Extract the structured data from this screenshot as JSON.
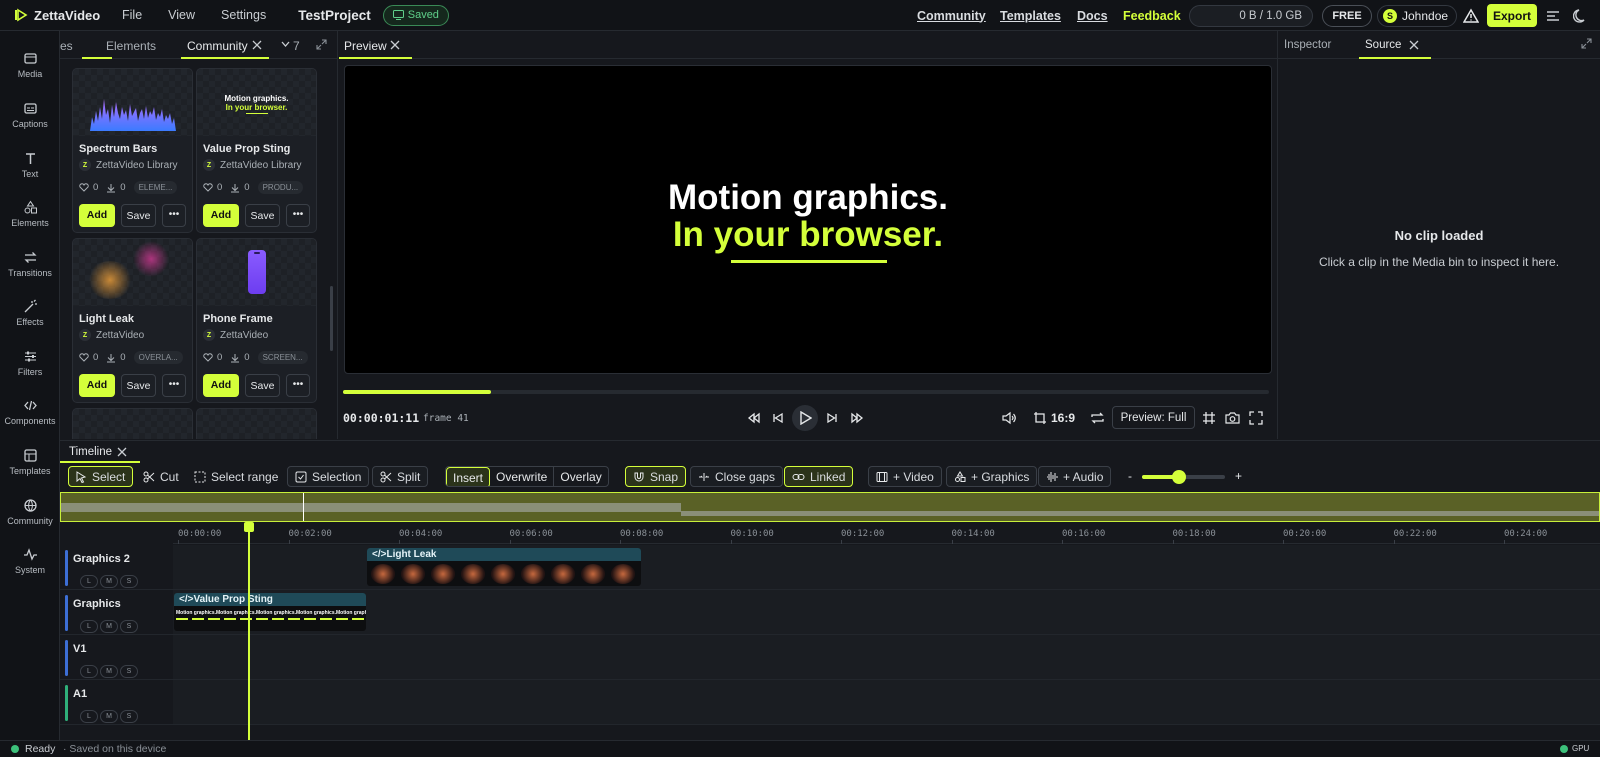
{
  "app": {
    "name": "ZettaVideo",
    "menu": [
      "File",
      "View",
      "Settings"
    ],
    "project": "TestProject",
    "saved": "Saved"
  },
  "toplinks": {
    "community": "Community",
    "templates": "Templates",
    "docs": "Docs",
    "feedback": "Feedback"
  },
  "storage": "0 B / 1.0 GB",
  "plan": "FREE",
  "user": {
    "initial": "S",
    "name": "Johndoe"
  },
  "export_label": "Export",
  "rail": [
    "Media",
    "Captions",
    "Text",
    "Elements",
    "Transitions",
    "Effects",
    "Filters",
    "Components",
    "Templates",
    "Community",
    "System"
  ],
  "library": {
    "tabs": {
      "partial": "es",
      "elements": "Elements",
      "community": "Community",
      "overflow": "7"
    },
    "cards": [
      {
        "title": "Spectrum Bars",
        "author": "ZettaVideo Library",
        "likes": "0",
        "downloads": "0",
        "tag": "ELEME...",
        "add": "Add",
        "save": "Save"
      },
      {
        "title": "Value Prop Sting",
        "author": "ZettaVideo Library",
        "likes": "0",
        "downloads": "0",
        "tag": "PRODU...",
        "add": "Add",
        "save": "Save",
        "thumb_l1": "Motion graphics.",
        "thumb_l2": "In your browser."
      },
      {
        "title": "Light Leak",
        "author": "ZettaVideo",
        "likes": "0",
        "downloads": "0",
        "tag": "OVERLA...",
        "add": "Add",
        "save": "Save"
      },
      {
        "title": "Phone Frame",
        "author": "ZettaVideo",
        "likes": "0",
        "downloads": "0",
        "tag": "SCREEN...",
        "add": "Add",
        "save": "Save"
      }
    ]
  },
  "preview": {
    "tab": "Preview",
    "line1": "Motion graphics.",
    "line2": "In your browser.",
    "timecode": "00:00:01:11",
    "frame": "frame 41",
    "progress": 0.16,
    "aspect": "16:9",
    "quality": "Preview: Full"
  },
  "inspector": {
    "tab1": "Inspector",
    "tab2": "Source",
    "empty_title": "No clip loaded",
    "empty_hint": "Click a clip in the Media bin to inspect it here."
  },
  "timeline": {
    "tab": "Timeline",
    "tools": {
      "select": "Select",
      "cut": "Cut",
      "select_range": "Select range",
      "selection": "Selection",
      "split": "Split"
    },
    "modes": [
      "Insert",
      "Overwrite",
      "Overlay"
    ],
    "snap": "Snap",
    "close_gaps": "Close gaps",
    "linked": "Linked",
    "add_video": "+ Video",
    "add_graphics": "+ Graphics",
    "add_audio": "+ Audio",
    "zoom_minus": "-",
    "zoom_plus": "+",
    "ruler": [
      "00:00:00",
      "00:02:00",
      "00:04:00",
      "00:06:00",
      "00:08:00",
      "00:10:00",
      "00:12:00",
      "00:14:00",
      "00:16:00",
      "00:18:00",
      "00:20:00",
      "00:22:00",
      "00:24:00"
    ],
    "tracks": [
      {
        "name": "Graphics 2",
        "color": "#3d6fd6"
      },
      {
        "name": "Graphics",
        "color": "#3d6fd6"
      },
      {
        "name": "V1",
        "color": "#3d6fd6"
      },
      {
        "name": "A1",
        "color": "#2fb07a"
      }
    ],
    "lms": [
      "L",
      "M",
      "S"
    ],
    "clips": {
      "light_leak": "</>Light Leak",
      "value_prop": "</>Value Prop Sting",
      "strip_text": "Motion graphics.Motion graphics.Motion graphics.Motion graphics.Motion graphics."
    }
  },
  "status": {
    "ready": "Ready",
    "saved": "· Saved on this device",
    "gpu": "GPU"
  }
}
